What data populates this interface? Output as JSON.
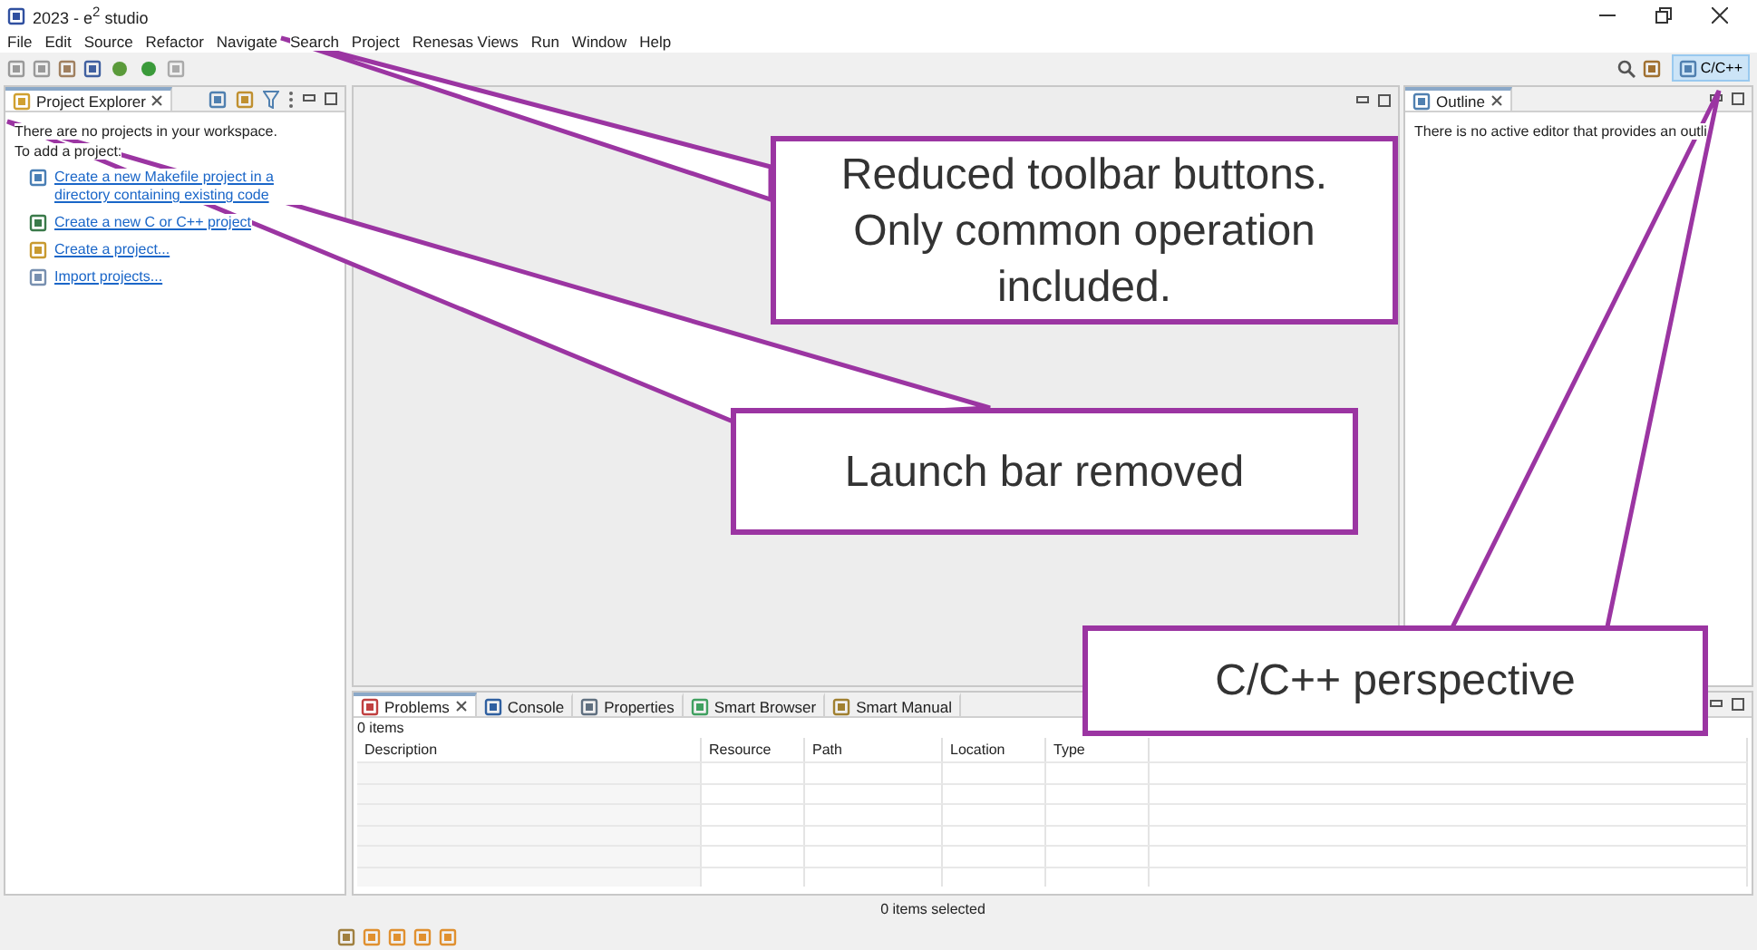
{
  "window": {
    "title": "2023 - e$^{2}$ studio"
  },
  "menu": [
    "File",
    "Edit",
    "Source",
    "Refactor",
    "Navigate",
    "Search",
    "Project",
    "Renesas Views",
    "Run",
    "Window",
    "Help"
  ],
  "perspective": {
    "label": "C/C++",
    "selected": true
  },
  "project_explorer": {
    "title": "Project Explorer",
    "selected": true,
    "message": [
      "There are no projects in your workspace.",
      "To add a project:"
    ],
    "links": [
      {
        "kind": "makefile",
        "text": "Create a new Makefile project in a directory containing existing code"
      },
      {
        "kind": "cproject",
        "text": "Create a new C or C++ project"
      },
      {
        "kind": "project",
        "text": "Create a project..."
      },
      {
        "kind": "import",
        "text": "Import projects..."
      }
    ]
  },
  "outline": {
    "title": "Outline",
    "selected": true,
    "message": "There is no active editor that provides an outli"
  },
  "bottom_panel": {
    "tabs": [
      {
        "label": "Problems",
        "kind": "problems",
        "selected": true
      },
      {
        "label": "Console",
        "kind": "console",
        "selected": false
      },
      {
        "label": "Properties",
        "kind": "properties",
        "selected": false
      },
      {
        "label": "Smart Browser",
        "kind": "browser",
        "selected": false
      },
      {
        "label": "Smart Manual",
        "kind": "manual",
        "selected": false
      }
    ],
    "count": "0 items",
    "columns": [
      "Description",
      "Resource",
      "Path",
      "Location",
      "Type"
    ]
  },
  "status_bar": "0 items selected",
  "callouts": [
    {
      "text": "Reduced toolbar buttons. Only common operation included."
    },
    {
      "text": "Launch bar removed"
    },
    {
      "text": "C/C++ perspective"
    }
  ]
}
